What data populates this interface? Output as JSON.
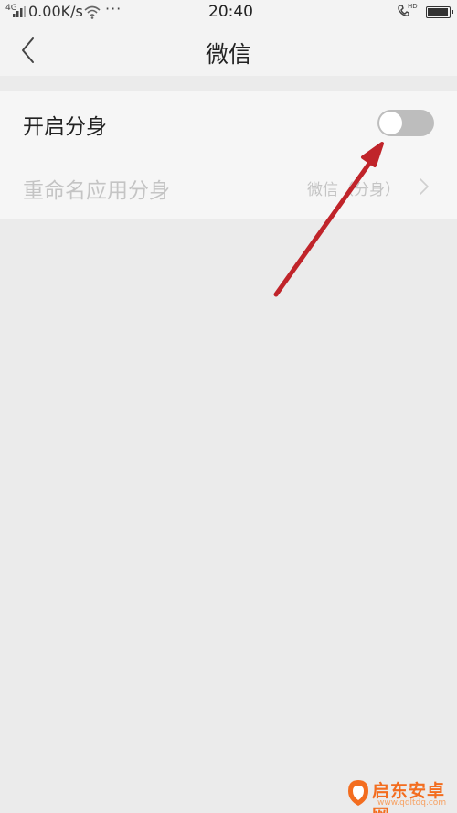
{
  "status_bar": {
    "network": "4G",
    "speed": "0.00K/s",
    "dots": "···",
    "time": "20:40",
    "hd": "HD"
  },
  "header": {
    "title": "微信",
    "back_icon": "chevron-left-icon"
  },
  "settings": {
    "clone_label": "开启分身",
    "clone_enabled": false,
    "rename_label": "重命名应用分身",
    "rename_value": "微信（分身）"
  },
  "annotation": {
    "arrow_color": "#c0242a"
  },
  "watermark": {
    "name": "启东安卓网",
    "url": "www.qdltdq.com"
  },
  "colors": {
    "background": "#ebebeb",
    "bar": "#f3f3f3",
    "toggle_off": "#bdbdbd",
    "disabled_text": "#c4c4c4"
  }
}
